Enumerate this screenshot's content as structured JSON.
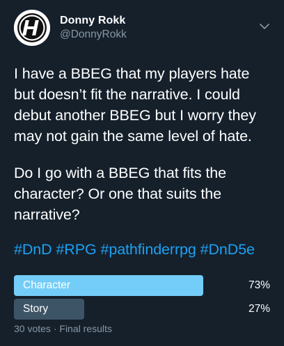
{
  "author": {
    "display_name": "Donny Rokk",
    "handle": "@DonnyRokk"
  },
  "tweet": {
    "paragraph1": "I have a BBEG that my players hate but doesn’t fit the narrative. I could debut another BBEG but I worry they may not gain the same level of hate.",
    "paragraph2": "Do I go with a BBEG that fits the character? Or one that suits the narrative?",
    "hashtags": [
      "#DnD",
      "#RPG",
      "#pathfinderrpg",
      "#DnD5e"
    ]
  },
  "poll": {
    "options": [
      {
        "label": "Character",
        "percent_text": "73%",
        "percent": 73,
        "winner": true
      },
      {
        "label": "Story",
        "percent_text": "27%",
        "percent": 27,
        "winner": false
      }
    ],
    "votes_text": "30 votes",
    "separator": " · ",
    "status_text": "Final results"
  },
  "icons": {
    "avatar": "hr-logo-avatar",
    "menu": "chevron-down-icon"
  },
  "colors": {
    "background": "#15202b",
    "link": "#1da1f2",
    "muted": "#8899a6",
    "poll_winner": "#74cdf8",
    "poll_other": "#3d5466"
  }
}
